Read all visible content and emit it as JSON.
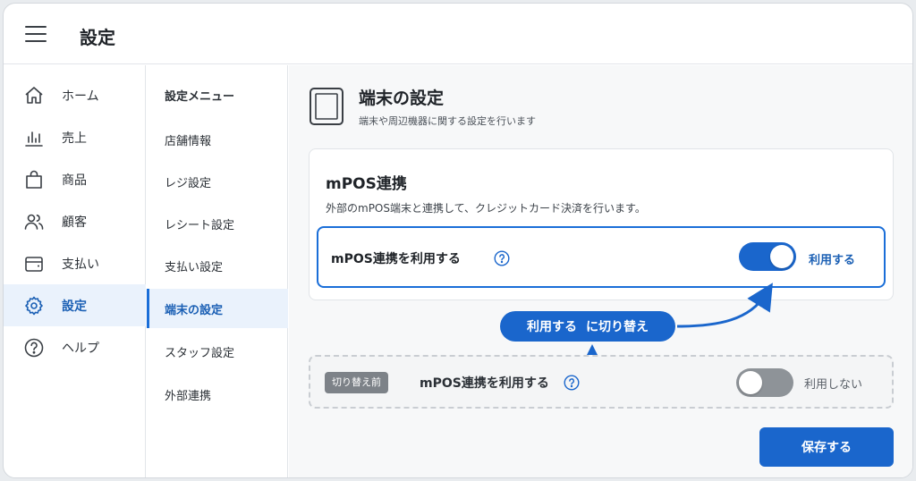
{
  "header": {
    "title": "設定"
  },
  "sidebar": {
    "items": [
      {
        "label": "ホーム",
        "icon": "home-icon"
      },
      {
        "label": "売上",
        "icon": "bar-chart-icon"
      },
      {
        "label": "商品",
        "icon": "shopping-bag-icon"
      },
      {
        "label": "顧客",
        "icon": "users-icon"
      },
      {
        "label": "支払い",
        "icon": "wallet-icon"
      },
      {
        "label": "設定",
        "icon": "gear-icon",
        "active": true
      },
      {
        "label": "ヘルプ",
        "icon": "help-circle-icon"
      }
    ]
  },
  "submenu": {
    "title": "設定メニュー",
    "items": [
      {
        "label": "店舗情報"
      },
      {
        "label": "レジ設定"
      },
      {
        "label": "レシート設定"
      },
      {
        "label": "支払い設定"
      },
      {
        "label": "端末の設定",
        "active": true
      },
      {
        "label": "スタッフ設定"
      },
      {
        "label": "外部連携"
      }
    ]
  },
  "main": {
    "title": "端末の設定",
    "subtitle": "端末や周辺機器に関する設定を行います",
    "card": {
      "title": "mPOS連携",
      "description": "外部のmPOS端末と連携して、クレジットカード決済を行います。",
      "setting": {
        "label": "mPOS連携を利用する",
        "toggle_on": true,
        "toggle_text": "利用する"
      }
    },
    "callout": {
      "part1": "利用する",
      "part2": "に切り替え"
    },
    "before": {
      "badge": "切り替え前",
      "label": "mPOS連携を利用する",
      "toggle_on": false,
      "toggle_text": "利用しない"
    },
    "save_label": "保存する"
  },
  "colors": {
    "accent": "#1a66cc",
    "active_bg": "#eaf2fc",
    "toggle_off": "#8e9398",
    "badge_gray": "#7d8288"
  }
}
